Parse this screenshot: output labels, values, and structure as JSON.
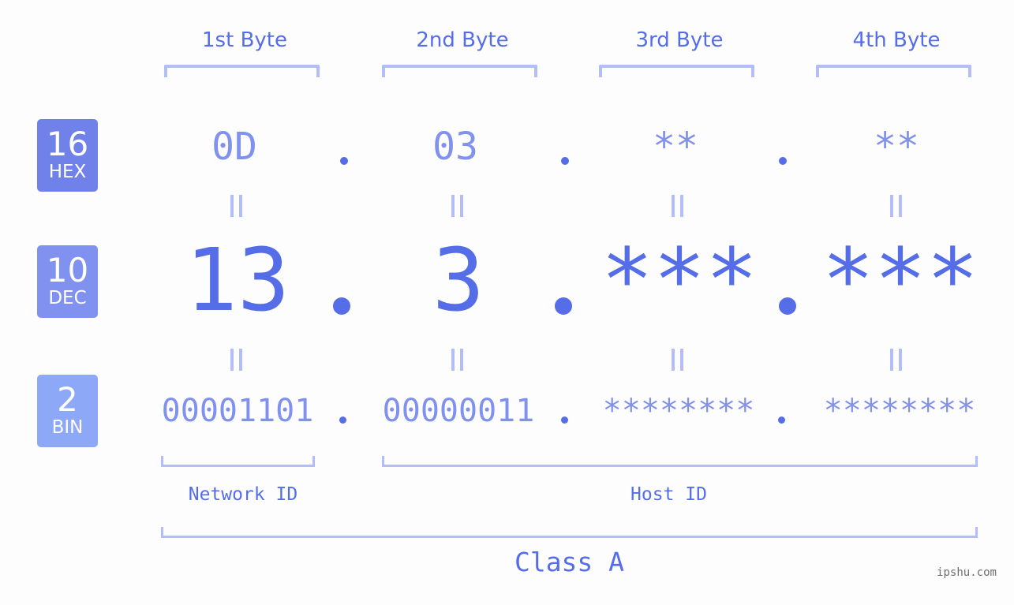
{
  "bases": [
    {
      "number": "16",
      "label": "HEX",
      "color": "#7082ea"
    },
    {
      "number": "10",
      "label": "DEC",
      "color": "#8091f0"
    },
    {
      "number": "2",
      "label": "BIN",
      "color": "#8ea8f8"
    }
  ],
  "byte_headers": [
    "1st Byte",
    "2nd Byte",
    "3rd Byte",
    "4th Byte"
  ],
  "hex": [
    "0D",
    "03",
    "**",
    "**"
  ],
  "dec": [
    "13",
    "3",
    "***",
    "***"
  ],
  "bin": [
    "00001101",
    "00000011",
    "********",
    "********"
  ],
  "segments": {
    "network_id": "Network ID",
    "host_id": "Host ID",
    "class": "Class A"
  },
  "watermark": "ipshu.com",
  "colors": {
    "primary": "#566de8",
    "secondary": "#8091ee",
    "bracket": "#b3bdf7",
    "background": "#fcfdfc"
  }
}
